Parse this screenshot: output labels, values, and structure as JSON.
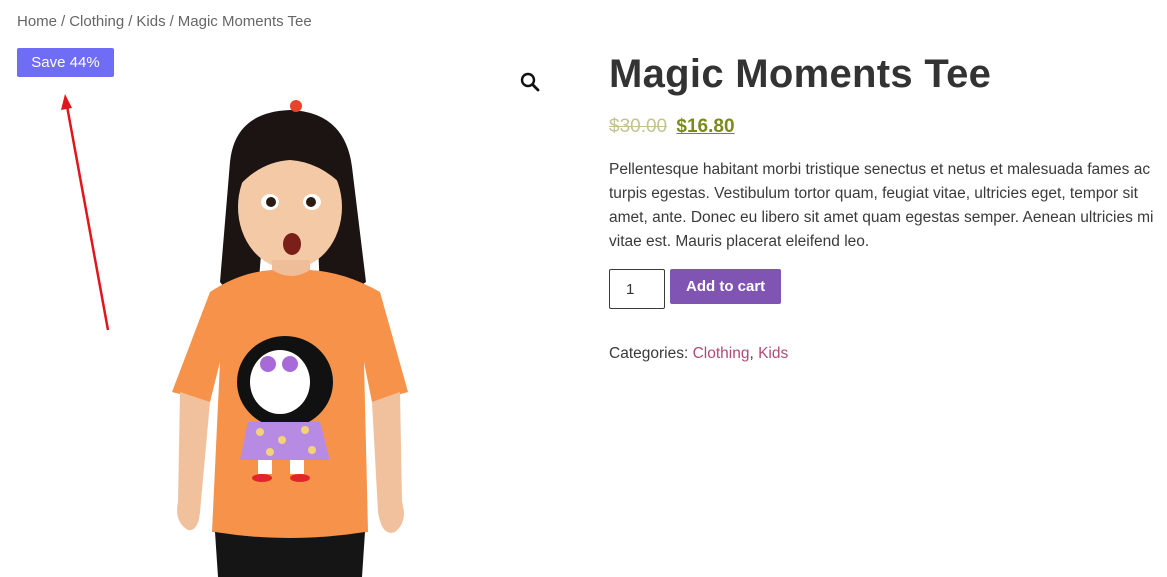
{
  "breadcrumb": {
    "home": "Home",
    "separator": "/",
    "category": "Clothing",
    "subcategory": "Kids",
    "current": "Magic Moments Tee"
  },
  "badge": {
    "label": "Save 44%",
    "color": "#6f6cf6"
  },
  "gallery": {
    "zoom_icon": "magnifier-icon",
    "image_description": "product-photo-girl-orange-tee"
  },
  "product": {
    "title": "Magic Moments Tee",
    "regular_price": "$30.00",
    "sale_price": "$16.80",
    "description": "Pellentesque habitant morbi tristique senectus et netus et malesuada fames ac turpis egestas. Vestibulum tortor quam, feugiat vitae, ultricies eget, tempor sit amet, ante. Donec eu libero sit amet quam egestas semper. Aenean ultricies mi vitae est. Mauris placerat eleifend leo.",
    "quantity": "1",
    "add_to_cart_label": "Add to cart",
    "add_to_cart_color": "#7f54b3",
    "categories_label": "Categories:",
    "categories": [
      "Clothing",
      "Kids"
    ],
    "categories_separator": ","
  }
}
